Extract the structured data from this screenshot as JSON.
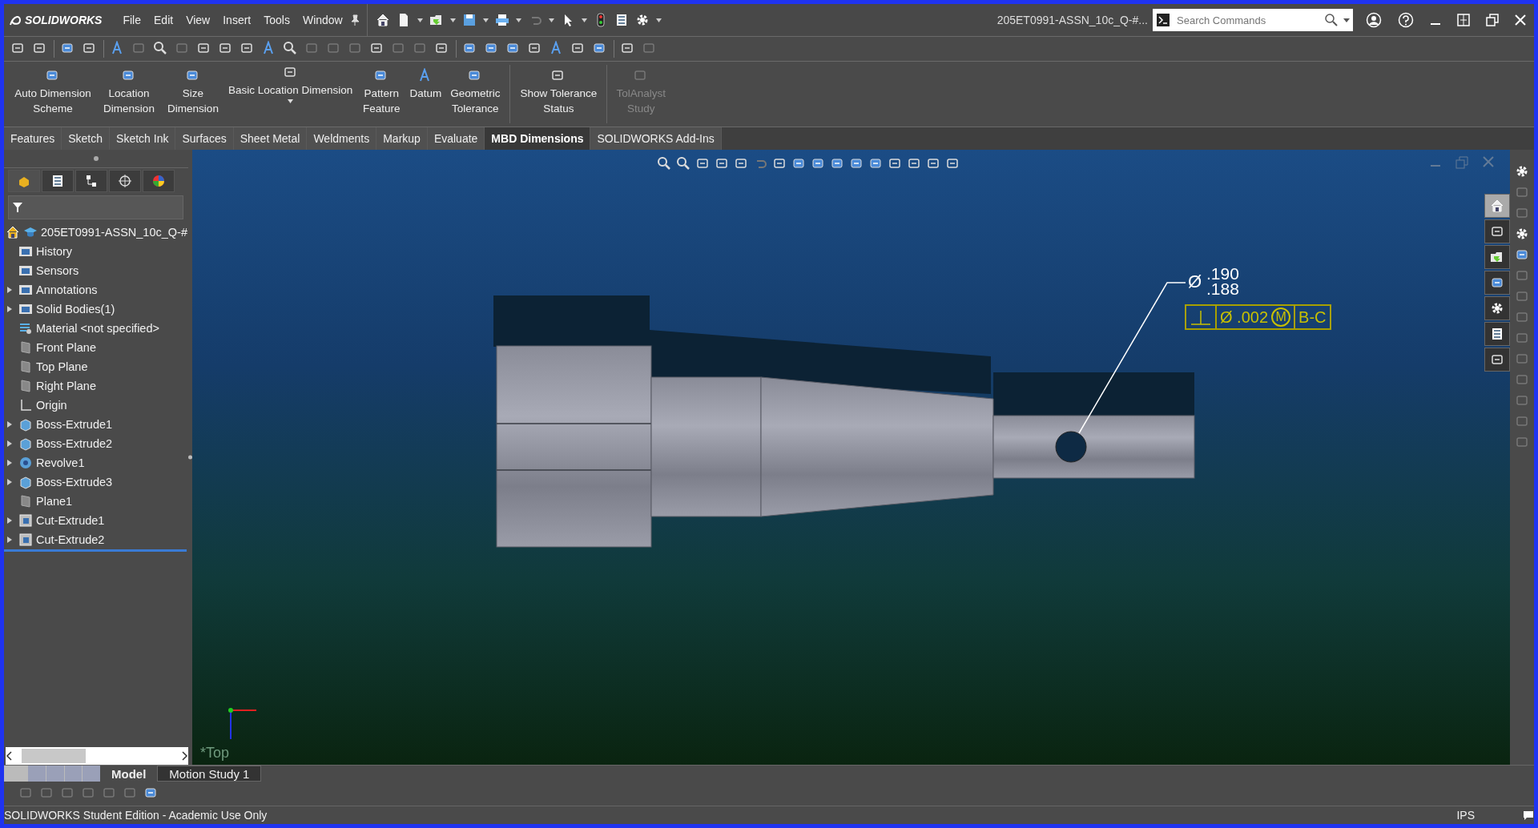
{
  "app": {
    "logo": "SOLIDWORKS"
  },
  "menu": [
    "File",
    "Edit",
    "View",
    "Insert",
    "Tools",
    "Window"
  ],
  "document_title": "205ET0991-ASSN_10c_Q-#...",
  "search": {
    "placeholder": "Search Commands"
  },
  "commands": [
    {
      "label": "Auto Dimension Scheme",
      "kind": "normal",
      "disabled": false
    },
    {
      "label": "Location Dimension",
      "kind": "normal",
      "disabled": false
    },
    {
      "label": "Size Dimension",
      "kind": "normal",
      "disabled": false
    },
    {
      "label": "Basic Location Dimension",
      "kind": "split",
      "disabled": false
    },
    {
      "label": "Pattern Feature",
      "kind": "normal",
      "disabled": false
    },
    {
      "label": "Datum",
      "kind": "normal",
      "disabled": false
    },
    {
      "label": "Geometric Tolerance",
      "kind": "normal",
      "disabled": false
    },
    {
      "label": "Show Tolerance Status",
      "kind": "normal",
      "disabled": false
    },
    {
      "label": "TolAnalyst Study",
      "kind": "normal",
      "disabled": true
    }
  ],
  "tabs": [
    {
      "label": "Features",
      "selected": false
    },
    {
      "label": "Sketch",
      "selected": false
    },
    {
      "label": "Sketch Ink",
      "selected": false
    },
    {
      "label": "Surfaces",
      "selected": false
    },
    {
      "label": "Sheet Metal",
      "selected": false
    },
    {
      "label": "Weldments",
      "selected": false
    },
    {
      "label": "Markup",
      "selected": false
    },
    {
      "label": "Evaluate",
      "selected": false
    },
    {
      "label": "MBD Dimensions",
      "selected": true
    },
    {
      "label": "SOLIDWORKS Add-Ins",
      "selected": false
    }
  ],
  "feature_tree": {
    "root": "205ET0991-ASSN_10c_Q-#",
    "items": [
      {
        "label": "History",
        "kind": "folder",
        "expandable": false
      },
      {
        "label": "Sensors",
        "kind": "folder",
        "expandable": false
      },
      {
        "label": "Annotations",
        "kind": "folder",
        "expandable": true
      },
      {
        "label": "Solid Bodies(1)",
        "kind": "folder",
        "expandable": true
      },
      {
        "label": "Material <not specified>",
        "kind": "material",
        "expandable": false
      },
      {
        "label": "Front Plane",
        "kind": "plane",
        "expandable": false
      },
      {
        "label": "Top Plane",
        "kind": "plane",
        "expandable": false
      },
      {
        "label": "Right Plane",
        "kind": "plane",
        "expandable": false
      },
      {
        "label": "Origin",
        "kind": "origin",
        "expandable": false
      },
      {
        "label": "Boss-Extrude1",
        "kind": "extrude",
        "expandable": true
      },
      {
        "label": "Boss-Extrude2",
        "kind": "extrude",
        "expandable": true
      },
      {
        "label": "Revolve1",
        "kind": "revolve",
        "expandable": true
      },
      {
        "label": "Boss-Extrude3",
        "kind": "extrude",
        "expandable": true
      },
      {
        "label": "Plane1",
        "kind": "plane",
        "expandable": false
      },
      {
        "label": "Cut-Extrude1",
        "kind": "cut",
        "expandable": true
      },
      {
        "label": "Cut-Extrude2",
        "kind": "cut",
        "expandable": true
      }
    ]
  },
  "annotation": {
    "diameter_symbol": "Ø",
    "upper": ".190",
    "lower": ".188",
    "feature_control_frame": {
      "tolerance_symbol": "Ø",
      "value": ".002",
      "modifier": "M",
      "datum": "B-C"
    }
  },
  "view_name": "*Top",
  "bottom_tabs": [
    {
      "label": "Model",
      "selected": true
    },
    {
      "label": "Motion Study 1",
      "selected": false
    }
  ],
  "status_bar": {
    "text": "SOLIDWORKS Student Edition - Academic Use Only",
    "units": "IPS"
  }
}
